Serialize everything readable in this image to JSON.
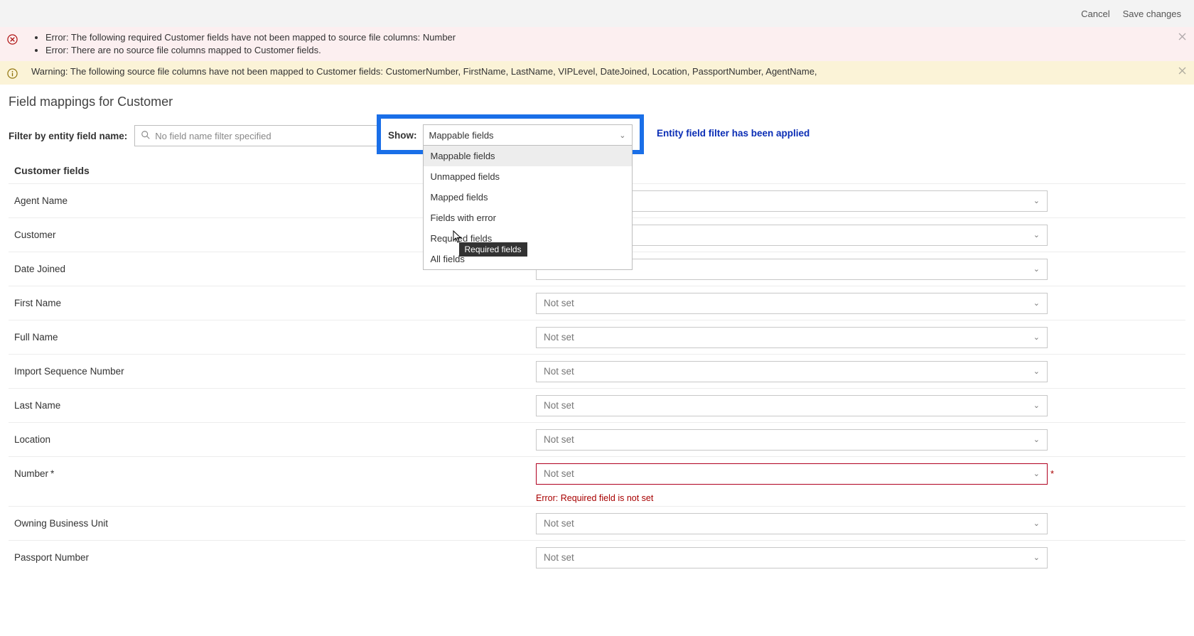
{
  "topbar": {
    "cancel": "Cancel",
    "save": "Save changes"
  },
  "alerts": {
    "error1": "Error: The following required Customer fields have not been mapped to source file columns: Number",
    "error2": "Error: There are no source file columns mapped to Customer fields.",
    "warning": "Warning: The following source file columns have not been mapped to Customer fields: CustomerNumber, FirstName, LastName, VIPLevel, DateJoined, Location, PassportNumber, AgentName,"
  },
  "page_title": "Field mappings for Customer",
  "filter": {
    "label": "Filter by entity field name:",
    "placeholder": "No field name filter specified",
    "show_label": "Show:",
    "selected": "Mappable fields",
    "options": {
      "o0": "Mappable fields",
      "o1": "Unmapped fields",
      "o2": "Mapped fields",
      "o3": "Fields with error",
      "o4": "Required fields",
      "o5": "All fields"
    },
    "tooltip": "Required fields",
    "applied_msg": "Entity field filter has been applied"
  },
  "fields_header": "Customer fields",
  "rows": {
    "r0": {
      "label": "Agent Name",
      "value": ""
    },
    "r1": {
      "label": "Customer",
      "value": ""
    },
    "r2": {
      "label": "Date Joined",
      "value": ""
    },
    "r3": {
      "label": "First Name",
      "value": "Not set"
    },
    "r4": {
      "label": "Full Name",
      "value": "Not set"
    },
    "r5": {
      "label": "Import Sequence Number",
      "value": "Not set"
    },
    "r6": {
      "label": "Last Name",
      "value": "Not set"
    },
    "r7": {
      "label": "Location",
      "value": "Not set"
    },
    "r8": {
      "label": "Number",
      "required_mark": "*",
      "value": "Not set",
      "error": "Error: Required field is not set"
    },
    "r9": {
      "label": "Owning Business Unit",
      "value": "Not set"
    },
    "r10": {
      "label": "Passport Number",
      "value": "Not set"
    }
  }
}
